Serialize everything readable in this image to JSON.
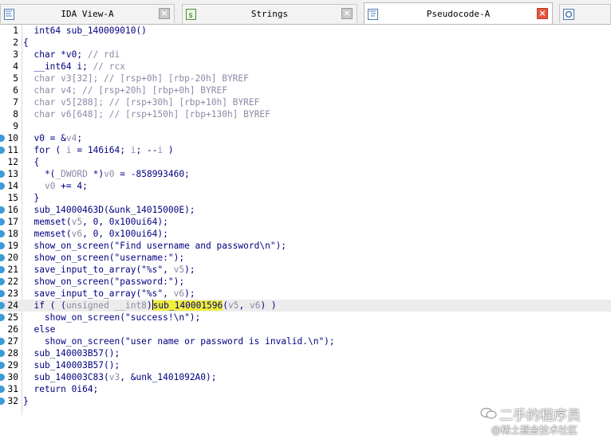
{
  "tabs": [
    {
      "label": "IDA View-A",
      "icon": "ida-view-icon",
      "active": false,
      "close": "×"
    },
    {
      "label": "Strings",
      "icon": "strings-icon",
      "active": false,
      "close": "×"
    },
    {
      "label": "Pseudocode-A",
      "icon": "pseudocode-icon",
      "active": true,
      "close": "×"
    },
    {
      "label": "",
      "icon": "hex-view-icon",
      "active": false
    }
  ],
  "code_lines": [
    {
      "n": "1",
      "marker": false,
      "parts": [
        {
          "t": "  int64 sub_140009010()"
        }
      ]
    },
    {
      "n": "2",
      "marker": false,
      "parts": [
        {
          "t": "{"
        }
      ]
    },
    {
      "n": "3",
      "marker": false,
      "parts": [
        {
          "t": "  char *v0; "
        },
        {
          "t": "// rdi",
          "c": "dim"
        }
      ]
    },
    {
      "n": "4",
      "marker": false,
      "parts": [
        {
          "t": "  __int64 i; "
        },
        {
          "t": "// rcx",
          "c": "dim"
        }
      ]
    },
    {
      "n": "5",
      "marker": false,
      "parts": [
        {
          "t": "  char v3[32]; // [rsp+0h] [rbp-20h] BYREF",
          "c": "dim"
        }
      ]
    },
    {
      "n": "6",
      "marker": false,
      "parts": [
        {
          "t": "  char v4; // [rsp+20h] [rbp+0h] BYREF",
          "c": "dim"
        }
      ]
    },
    {
      "n": "7",
      "marker": false,
      "parts": [
        {
          "t": "  char v5[288]; // [rsp+30h] [rbp+10h] BYREF",
          "c": "dim"
        }
      ]
    },
    {
      "n": "8",
      "marker": false,
      "parts": [
        {
          "t": "  char v6[648]; // [rsp+150h] [rbp+130h] BYREF",
          "c": "dim"
        }
      ]
    },
    {
      "n": "9",
      "marker": false,
      "parts": [
        {
          "t": ""
        }
      ]
    },
    {
      "n": "10",
      "marker": true,
      "parts": [
        {
          "t": "  v0 = &"
        },
        {
          "t": "v4",
          "c": "dim"
        },
        {
          "t": ";"
        }
      ]
    },
    {
      "n": "11",
      "marker": true,
      "parts": [
        {
          "t": "  for ( "
        },
        {
          "t": "i",
          "c": "dim"
        },
        {
          "t": " = 146i64; "
        },
        {
          "t": "i",
          "c": "dim"
        },
        {
          "t": "; --"
        },
        {
          "t": "i",
          "c": "dim"
        },
        {
          "t": " )"
        }
      ]
    },
    {
      "n": "12",
      "marker": false,
      "parts": [
        {
          "t": "  {"
        }
      ]
    },
    {
      "n": "13",
      "marker": true,
      "parts": [
        {
          "t": "    *("
        },
        {
          "t": "_DWORD",
          "c": "dim"
        },
        {
          "t": " *)"
        },
        {
          "t": "v0",
          "c": "dim"
        },
        {
          "t": " = -858993460;"
        }
      ]
    },
    {
      "n": "14",
      "marker": true,
      "parts": [
        {
          "t": "    "
        },
        {
          "t": "v0",
          "c": "dim"
        },
        {
          "t": " += 4;"
        }
      ]
    },
    {
      "n": "15",
      "marker": false,
      "parts": [
        {
          "t": "  }"
        }
      ]
    },
    {
      "n": "16",
      "marker": true,
      "parts": [
        {
          "t": "  sub_14000463D(&unk_14015000E);"
        }
      ]
    },
    {
      "n": "17",
      "marker": true,
      "parts": [
        {
          "t": "  memset("
        },
        {
          "t": "v5",
          "c": "dim"
        },
        {
          "t": ", 0, 0x100ui64);"
        }
      ]
    },
    {
      "n": "18",
      "marker": true,
      "parts": [
        {
          "t": "  memset("
        },
        {
          "t": "v6",
          "c": "dim"
        },
        {
          "t": ", 0, 0x100ui64);"
        }
      ]
    },
    {
      "n": "19",
      "marker": true,
      "parts": [
        {
          "t": "  show_on_screen(\"Find username and password\\n\");"
        }
      ]
    },
    {
      "n": "20",
      "marker": true,
      "parts": [
        {
          "t": "  show_on_screen(\"username:\");"
        }
      ]
    },
    {
      "n": "21",
      "marker": true,
      "parts": [
        {
          "t": "  save_input_to_array(\"%s\", "
        },
        {
          "t": "v5",
          "c": "dim"
        },
        {
          "t": ");"
        }
      ]
    },
    {
      "n": "22",
      "marker": true,
      "parts": [
        {
          "t": "  show_on_screen(\"password:\");"
        }
      ]
    },
    {
      "n": "23",
      "marker": true,
      "parts": [
        {
          "t": "  save_input_to_array(\"%s\", "
        },
        {
          "t": "v6",
          "c": "dim"
        },
        {
          "t": ");"
        }
      ]
    },
    {
      "n": "24",
      "marker": true,
      "hl": true,
      "parts": [
        {
          "t": "  if ( ("
        },
        {
          "t": "unsigned __int8",
          "c": "dim"
        },
        {
          "t": ")"
        },
        {
          "cursor": true
        },
        {
          "t": "sub_140001596",
          "c": "hlw"
        },
        {
          "t": "("
        },
        {
          "t": "v5",
          "c": "dim"
        },
        {
          "t": ", "
        },
        {
          "t": "v6",
          "c": "dim"
        },
        {
          "t": ") )"
        }
      ]
    },
    {
      "n": "25",
      "marker": true,
      "parts": [
        {
          "t": "    show_on_screen(\"success!\\n\");"
        }
      ]
    },
    {
      "n": "26",
      "marker": false,
      "parts": [
        {
          "t": "  else"
        }
      ]
    },
    {
      "n": "27",
      "marker": true,
      "parts": [
        {
          "t": "    show_on_screen(\"user name or password is invalid.\\n\");"
        }
      ]
    },
    {
      "n": "28",
      "marker": true,
      "parts": [
        {
          "t": "  sub_140003B57();"
        }
      ]
    },
    {
      "n": "29",
      "marker": true,
      "parts": [
        {
          "t": "  sub_140003B57();"
        }
      ]
    },
    {
      "n": "30",
      "marker": true,
      "parts": [
        {
          "t": "  sub_140003C83("
        },
        {
          "t": "v3",
          "c": "dim"
        },
        {
          "t": ", &unk_1401092A0);"
        }
      ]
    },
    {
      "n": "31",
      "marker": true,
      "parts": [
        {
          "t": "  return 0i64;"
        }
      ]
    },
    {
      "n": "32",
      "marker": true,
      "parts": [
        {
          "t": "}"
        }
      ]
    }
  ],
  "watermark": {
    "line1": "二手的程序员",
    "line2": "@稀土掘金技术社区",
    "icon": "wechat-icon"
  },
  "colors": {
    "marker": "#3c9bd6",
    "highlight": "#f2ef3a",
    "code": "#000080",
    "dim": "#8a8aa8",
    "active_close": "#e8553d"
  }
}
